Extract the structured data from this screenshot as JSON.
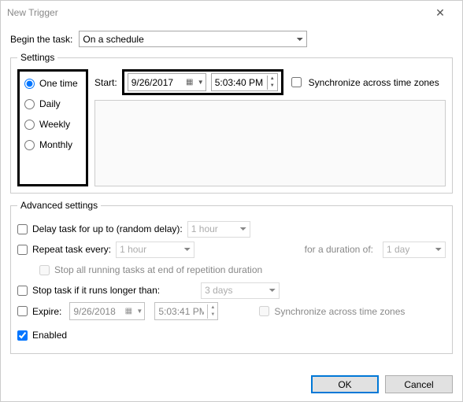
{
  "window": {
    "title": "New Trigger"
  },
  "begin": {
    "label": "Begin the task:",
    "value": "On a schedule"
  },
  "settings": {
    "legend": "Settings",
    "schedule": {
      "one_time": "One time",
      "daily": "Daily",
      "weekly": "Weekly",
      "monthly": "Monthly"
    },
    "start_label": "Start:",
    "date": "9/26/2017",
    "time": "5:03:40 PM",
    "sync_label": "Synchronize across time zones"
  },
  "advanced": {
    "legend": "Advanced settings",
    "delay_label": "Delay task for up to (random delay):",
    "delay_value": "1 hour",
    "repeat_label": "Repeat task every:",
    "repeat_value": "1 hour",
    "duration_label": "for a duration of:",
    "duration_value": "1 day",
    "stop_end_label": "Stop all running tasks at end of repetition duration",
    "stop_longer_label": "Stop task if it runs longer than:",
    "stop_longer_value": "3 days",
    "expire_label": "Expire:",
    "expire_date": "9/26/2018",
    "expire_time": "5:03:41 PM",
    "expire_sync_label": "Synchronize across time zones",
    "enabled_label": "Enabled"
  },
  "buttons": {
    "ok": "OK",
    "cancel": "Cancel"
  }
}
